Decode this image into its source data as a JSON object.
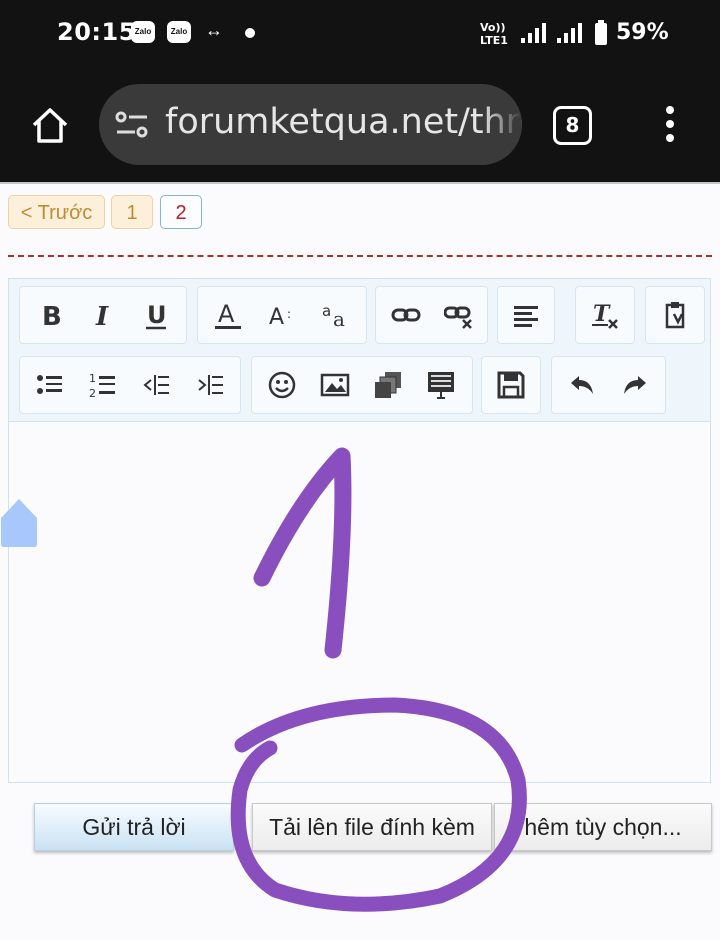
{
  "status_bar": {
    "time": "20:15",
    "notification_icons": [
      "Zalo",
      "Zalo"
    ],
    "signal_label": "Vo)) LTE1",
    "battery": "59%"
  },
  "browser": {
    "url": "forumketqua.net/thre",
    "tab_count": "8",
    "icons": [
      "home-icon",
      "site-settings-icon",
      "tab-switcher-icon",
      "more-vert-icon"
    ]
  },
  "pagination": {
    "prev_label": "< Trước",
    "pages": [
      "1",
      "2"
    ],
    "current_page": "2"
  },
  "editor": {
    "toolbar_row1": [
      "bold-icon",
      "italic-icon",
      "underline-icon",
      "text-color-icon",
      "font-size-icon",
      "font-name-icon",
      "link-icon",
      "unlink-icon",
      "align-icon",
      "remove-format-icon",
      "paste-icon"
    ],
    "toolbar_row2": [
      "bulleted-list-icon",
      "numbered-list-icon",
      "outdent-icon",
      "indent-icon",
      "smiley-icon",
      "image-icon",
      "media-icon",
      "quote-icon",
      "save-draft-icon",
      "undo-icon",
      "redo-icon"
    ],
    "content": ""
  },
  "form_buttons": {
    "submit_label": "Gửi trả lời",
    "upload_label": "Tải lên file đính kèm",
    "more_label": "Thêm tùy chọn..."
  },
  "annotation": {
    "handwritten_mark": "1",
    "color": "#8a4fbf"
  },
  "colors": {
    "status_bar_bg": "#121212",
    "page_bg": "#fbfbfe",
    "prev_button_bg": "#fdf0da",
    "current_page_text": "#b81f1f",
    "divider": "#b42b2b",
    "submit_button": "#c8e1f3"
  }
}
